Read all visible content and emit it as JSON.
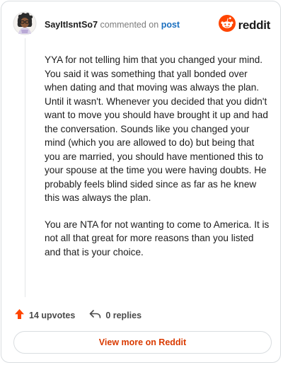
{
  "header": {
    "username": "SayItIsntSo7",
    "action_text": "commented on",
    "target_link": "post",
    "brand_name": "reddit",
    "brand_color": "#ff4500"
  },
  "icons": {
    "avatar": "user-avatar-icon",
    "brand": "reddit-logo-icon",
    "upvote": "upvote-arrow-icon",
    "reply": "reply-arrow-icon"
  },
  "comment": {
    "paragraphs": [
      "YYA for not telling him that you changed your mind. You said it was something that yall bonded over when dating and that moving was always the plan. Until it wasn't. Whenever you decided that you didn't want to move you should have brought it up and had the conversation. Sounds like you changed your mind (which you are allowed to do) but being that you are married, you should have mentioned this to your spouse at the time you were having doubts. He probably feels blind sided since as far as he knew this was always the plan.",
      "You are NTA for not wanting to come to America. It is not all that great for more reasons than you listed and that is your choice."
    ]
  },
  "actions": {
    "upvotes_label": "14 upvotes",
    "replies_label": "0 replies"
  },
  "cta": {
    "label": "View more on Reddit",
    "color": "#d93a00"
  }
}
